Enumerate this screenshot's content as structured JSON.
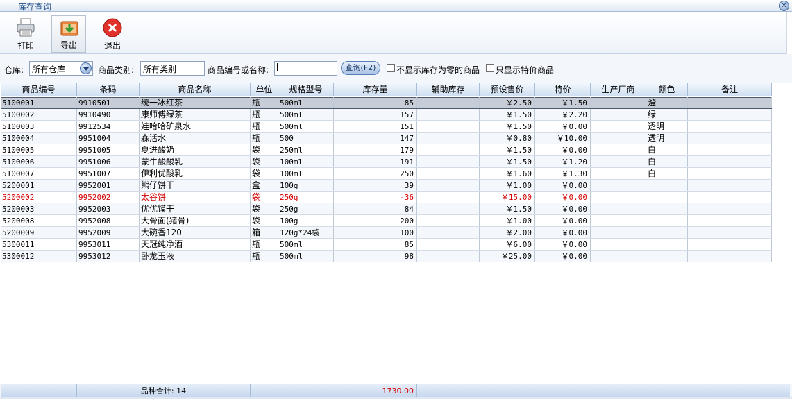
{
  "window": {
    "title": "库存查询"
  },
  "toolbar": {
    "print": "打印",
    "export": "导出",
    "exit": "退出"
  },
  "filters": {
    "warehouse_label": "仓库:",
    "warehouse_value": "所有仓库",
    "category_label": "商品类别:",
    "category_value": "所有类别",
    "code_label": "商品编号或名称:",
    "code_value": "",
    "query_button": "查询(F2)",
    "hide_zero_label": "不显示库存为零的商品",
    "special_only_label": "只显示特价商品"
  },
  "table": {
    "columns": [
      "商品编号",
      "条码",
      "商品名称",
      "单位",
      "规格型号",
      "库存量",
      "辅助库存",
      "预设售价",
      "特价",
      "生产厂商",
      "颜色",
      "备注"
    ],
    "rows": [
      [
        "5100001",
        "9910501",
        "统一冰红茶",
        "瓶",
        "500ml",
        "85",
        "",
        "￥2.50",
        "￥1.50",
        "",
        "澄",
        ""
      ],
      [
        "5100002",
        "9910490",
        "康师傅绿茶",
        "瓶",
        "500ml",
        "157",
        "",
        "￥1.50",
        "￥2.20",
        "",
        "绿",
        ""
      ],
      [
        "5100003",
        "9912534",
        "娃哈哈矿泉水",
        "瓶",
        "500ml",
        "151",
        "",
        "￥1.50",
        "￥0.00",
        "",
        "透明",
        ""
      ],
      [
        "5100004",
        "9951004",
        "森活水",
        "瓶",
        "500",
        "147",
        "",
        "￥0.80",
        "￥10.00",
        "",
        "透明",
        ""
      ],
      [
        "5100005",
        "9951005",
        "夏进酸奶",
        "袋",
        "250ml",
        "179",
        "",
        "￥1.50",
        "￥0.00",
        "",
        "白",
        ""
      ],
      [
        "5100006",
        "9951006",
        "蒙牛酸酸乳",
        "袋",
        "100ml",
        "191",
        "",
        "￥1.50",
        "￥1.20",
        "",
        "白",
        ""
      ],
      [
        "5100007",
        "9951007",
        "伊利优酸乳",
        "袋",
        "100ml",
        "250",
        "",
        "￥1.60",
        "￥1.30",
        "",
        "白",
        ""
      ],
      [
        "5200001",
        "9952001",
        "熊仔饼干",
        "盒",
        "100g",
        "39",
        "",
        "￥1.00",
        "￥0.00",
        "",
        "",
        ""
      ],
      [
        "5200002",
        "9952002",
        "太谷饼",
        "袋",
        "250g",
        "-36",
        "",
        "￥15.00",
        "￥0.00",
        "",
        "",
        ""
      ],
      [
        "5200003",
        "9952003",
        "优优馍干",
        "袋",
        "250g",
        "84",
        "",
        "￥1.50",
        "￥0.00",
        "",
        "",
        ""
      ],
      [
        "5200008",
        "9952008",
        "大骨面(猪骨)",
        "袋",
        "100g",
        "200",
        "",
        "￥1.00",
        "￥0.00",
        "",
        "",
        ""
      ],
      [
        "5200009",
        "9952009",
        "大碗香120",
        "箱",
        "120g*24袋",
        "100",
        "",
        "￥2.00",
        "￥0.00",
        "",
        "",
        ""
      ],
      [
        "5300011",
        "9953011",
        "天冠纯净酒",
        "瓶",
        "500ml",
        "85",
        "",
        "￥6.00",
        "￥0.00",
        "",
        "",
        ""
      ],
      [
        "5300012",
        "9953012",
        "卧龙玉液",
        "瓶",
        "500ml",
        "98",
        "",
        "￥25.00",
        "￥0.00",
        "",
        "",
        ""
      ]
    ]
  },
  "footer": {
    "count_label": "品种合计: 14",
    "stock_total": "1730.00"
  },
  "colors": {
    "negative_row": "#d40000",
    "header_bg": "#cfdff2",
    "accent": "#1c4d86"
  }
}
